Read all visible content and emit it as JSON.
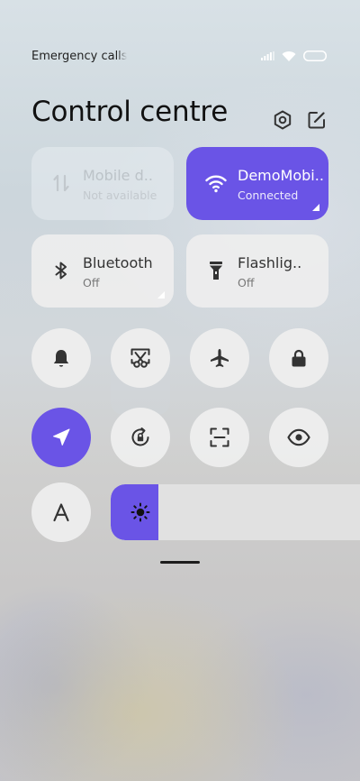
{
  "status_bar": {
    "text": "Emergency calls only",
    "icons": [
      "signal-icon",
      "wifi-icon",
      "battery-icon"
    ]
  },
  "header": {
    "title": "Control centre",
    "buttons": [
      "settings-icon",
      "edit-icon"
    ]
  },
  "tiles": [
    {
      "label": "Mobile data",
      "sub": "Not available",
      "icon": "mobile-data-icon",
      "state": "disabled"
    },
    {
      "label": "DemoMobile",
      "sub": "Connected",
      "icon": "wifi-icon",
      "state": "on"
    },
    {
      "label": "Bluetooth",
      "sub": "Off",
      "icon": "bluetooth-icon",
      "state": "off"
    },
    {
      "label": "Flashlight",
      "sub": "Off",
      "icon": "flashlight-icon",
      "state": "off"
    }
  ],
  "toggles": [
    {
      "icon": "bell-icon",
      "state": "off"
    },
    {
      "icon": "screenshot-scissors-icon",
      "state": "off"
    },
    {
      "icon": "airplane-icon",
      "state": "off"
    },
    {
      "icon": "lock-icon",
      "state": "off"
    },
    {
      "icon": "location-icon",
      "state": "on"
    },
    {
      "icon": "rotation-lock-icon",
      "state": "off"
    },
    {
      "icon": "scanner-icon",
      "state": "off"
    },
    {
      "icon": "eye-icon",
      "state": "off"
    },
    {
      "icon": "font-size-icon",
      "label": "A",
      "state": "off"
    }
  ],
  "brightness": {
    "icon": "sun-icon",
    "level": 0.19
  },
  "colors": {
    "accent": "#6a54e6",
    "tile_bg": "#eeeeee",
    "icon_dark": "#333333"
  }
}
